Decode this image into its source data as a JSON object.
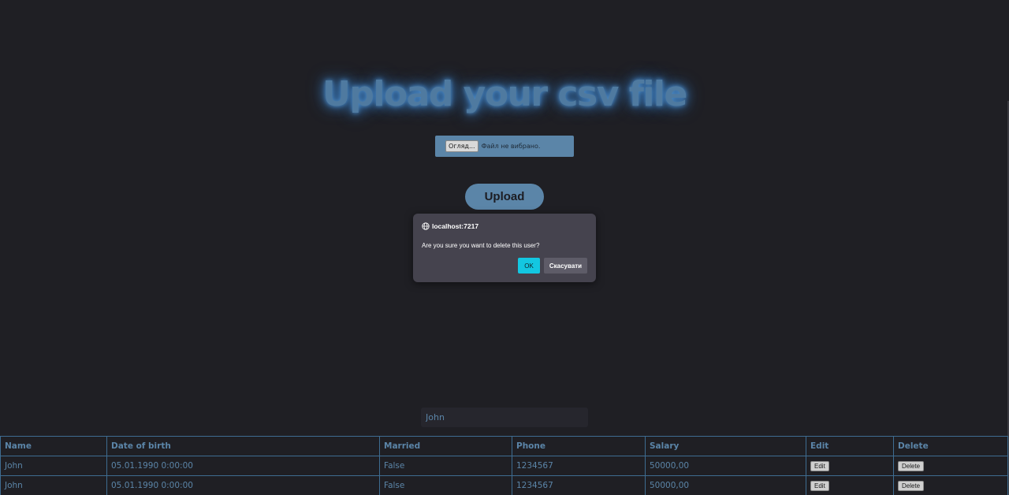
{
  "page": {
    "title": "Upload your csv file"
  },
  "file_input": {
    "browse_label": "Огляд...",
    "status": "Файл не вибрано."
  },
  "upload_button": {
    "label": "Upload"
  },
  "dialog": {
    "origin": "localhost:7217",
    "message": "Are you sure you want to delete this user?",
    "ok_label": "OK",
    "cancel_label": "Скасувати"
  },
  "search": {
    "value": "John"
  },
  "table": {
    "headers": {
      "name": "Name",
      "dob": "Date of birth",
      "married": "Married",
      "phone": "Phone",
      "salary": "Salary",
      "edit": "Edit",
      "delete": "Delete"
    },
    "rows": [
      {
        "name": "John",
        "dob": "05.01.1990 0:00:00",
        "married": "False",
        "phone": "1234567",
        "salary": "50000,00",
        "edit": "Edit",
        "delete": "Delete"
      },
      {
        "name": "John",
        "dob": "05.01.1990 0:00:00",
        "married": "False",
        "phone": "1234567",
        "salary": "50000,00",
        "edit": "Edit",
        "delete": "Delete"
      }
    ]
  },
  "colors": {
    "background": "#1f1f24",
    "accent": "#5b85a8",
    "dialog_background": "#45434e",
    "ok_button": "#13c7e1"
  },
  "icons": {
    "dialog_origin": "globe-icon"
  }
}
